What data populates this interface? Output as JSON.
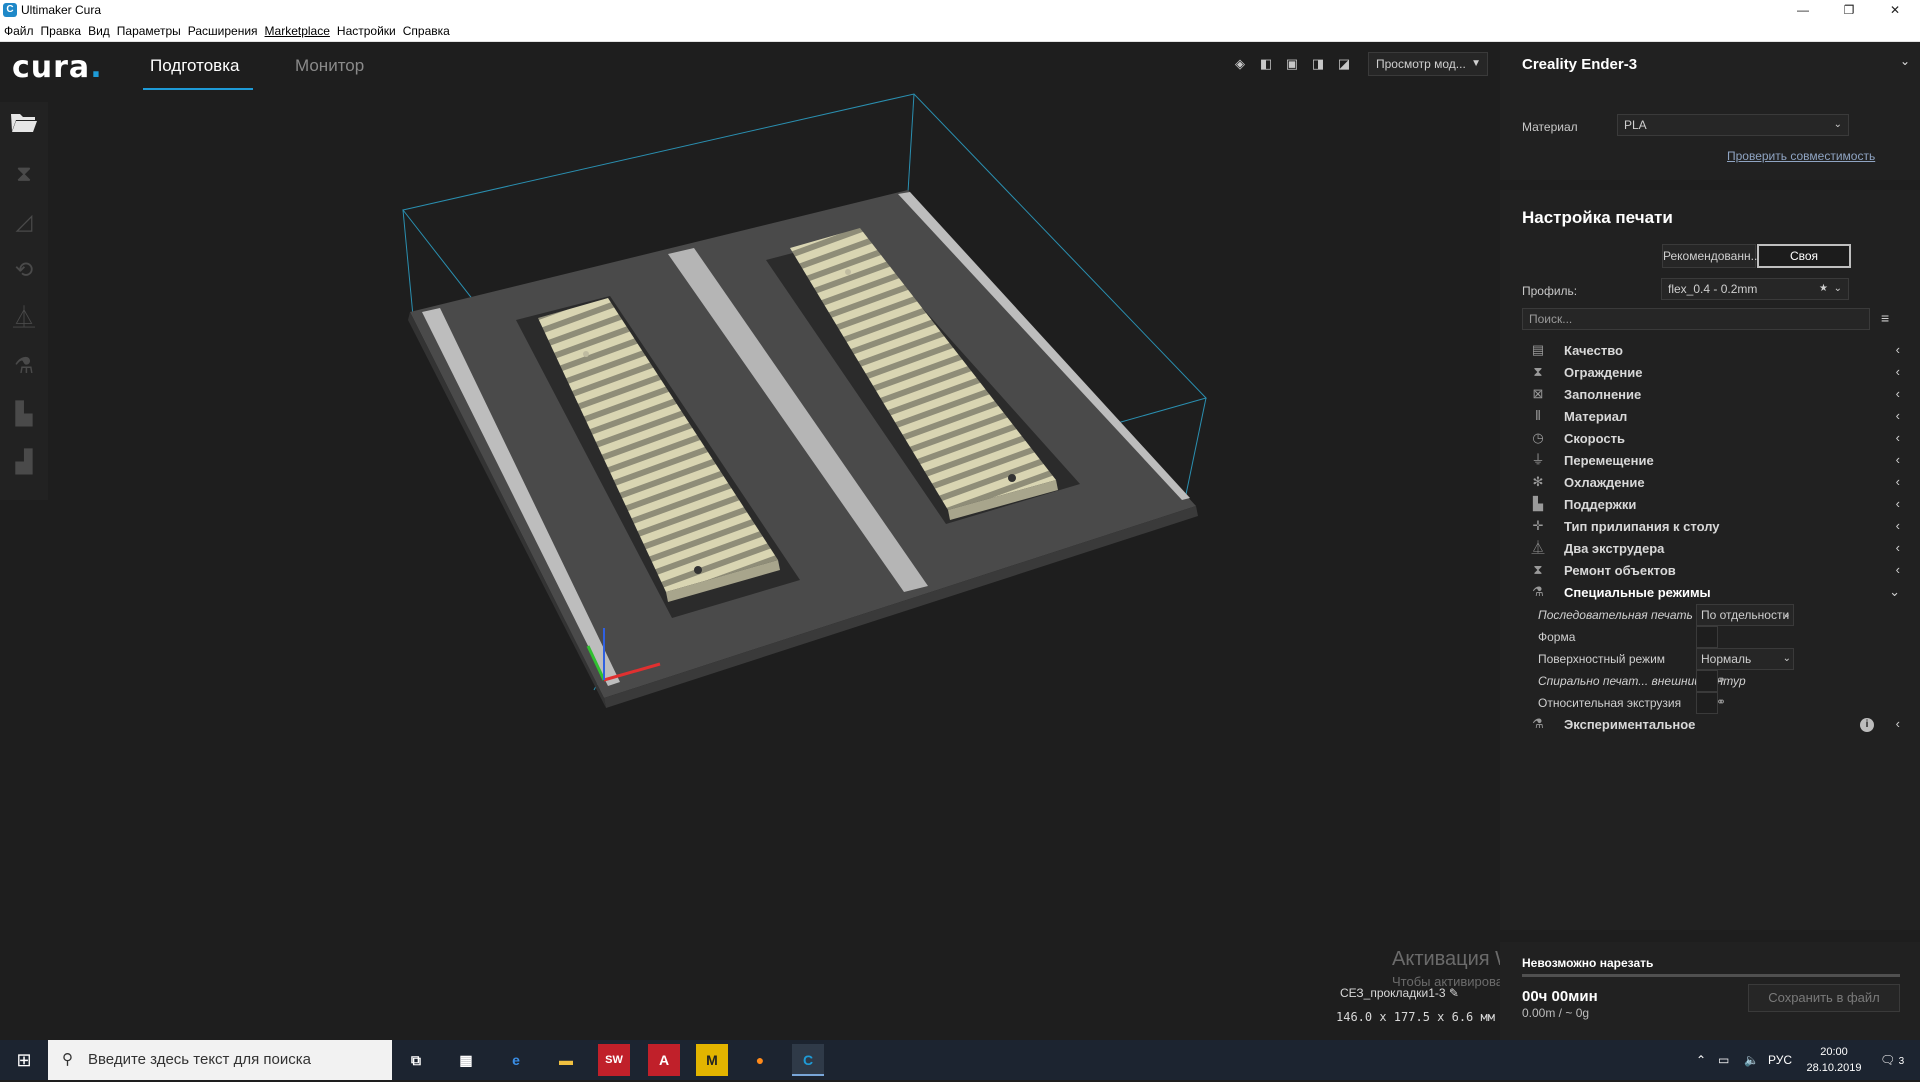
{
  "window": {
    "title": "Ultimaker Cura",
    "app_icon_letter": "C",
    "controls": [
      "—",
      "❐",
      "✕"
    ]
  },
  "menu": [
    "Файл",
    "Правка",
    "Вид",
    "Параметры",
    "Расширения",
    "Marketplace",
    "Настройки",
    "Справка"
  ],
  "header": {
    "logo": "cura",
    "logo_dot": ".",
    "tabs": [
      {
        "label": "Подготовка",
        "active": true
      },
      {
        "label": "Монитор",
        "active": false
      }
    ],
    "view_select": "Просмотр мод...",
    "view_icons": [
      "3d-view-icon",
      "front-view-icon",
      "top-view-icon",
      "left-view-icon",
      "right-view-icon"
    ]
  },
  "toolbar": {
    "tools": [
      "open-file-icon",
      "move-tool-icon",
      "scale-tool-icon",
      "rotate-tool-icon",
      "mirror-tool-icon",
      "per-model-settings-icon",
      "support-blocker-icon",
      "layer-tool-icon"
    ]
  },
  "printer": {
    "name": "Creality Ender-3",
    "material_label": "Материал",
    "material_value": "PLA",
    "compat_link": "Проверить совместимость"
  },
  "print_settings": {
    "title": "Настройка печати",
    "mode_recommended": "Рекомендованн...",
    "mode_custom": "Своя",
    "profile_label": "Профиль:",
    "profile_value": "flex_0.4 - 0.2mm",
    "search_placeholder": "Поиск...",
    "categories": [
      {
        "label": "Качество",
        "icon": "quality-icon"
      },
      {
        "label": "Ограждение",
        "icon": "shell-icon"
      },
      {
        "label": "Заполнение",
        "icon": "infill-icon"
      },
      {
        "label": "Материал",
        "icon": "material-icon"
      },
      {
        "label": "Скорость",
        "icon": "speed-icon"
      },
      {
        "label": "Перемещение",
        "icon": "travel-icon"
      },
      {
        "label": "Охлаждение",
        "icon": "cooling-icon"
      },
      {
        "label": "Поддержки",
        "icon": "support-icon"
      },
      {
        "label": "Тип прилипания к столу",
        "icon": "adhesion-icon"
      },
      {
        "label": "Два экструдера",
        "icon": "dual-extrusion-icon"
      },
      {
        "label": "Ремонт объектов",
        "icon": "mesh-fixes-icon"
      },
      {
        "label": "Специальные режимы",
        "icon": "special-modes-icon"
      }
    ],
    "special": {
      "sequence_label": "Последовательная печать",
      "sequence_value": "По отдельности",
      "mold_label": "Форма",
      "surface_label": "Поверхностный режим",
      "surface_value": "Нормаль",
      "spiral_label": "Спирально печат... внешний контур",
      "relative_label": "Относительная экструзия"
    },
    "experimental_label": "Экспериментальное"
  },
  "slice": {
    "status": "Невозможно нарезать",
    "time": "00ч 00мин",
    "material": "0.00m / ~ 0g",
    "save_button": "Сохранить в файл"
  },
  "object": {
    "name": "СЕЗ_прокладки1-3",
    "dims": "146.0 x 177.5 x 6.6 мм"
  },
  "activation": {
    "line1": "Активация Windows",
    "line2": "Чтобы активировать Windows, перейдите в раздел \"Параметры\"."
  },
  "taskbar": {
    "search_placeholder": "Введите здесь текст для поиска",
    "lang": "РУС",
    "time": "20:00",
    "date": "28.10.2019",
    "notif_count": "3"
  },
  "colors": {
    "accent": "#1e9bd7",
    "build_plate": "#4a4a4a",
    "model": "#d6d2b0"
  }
}
